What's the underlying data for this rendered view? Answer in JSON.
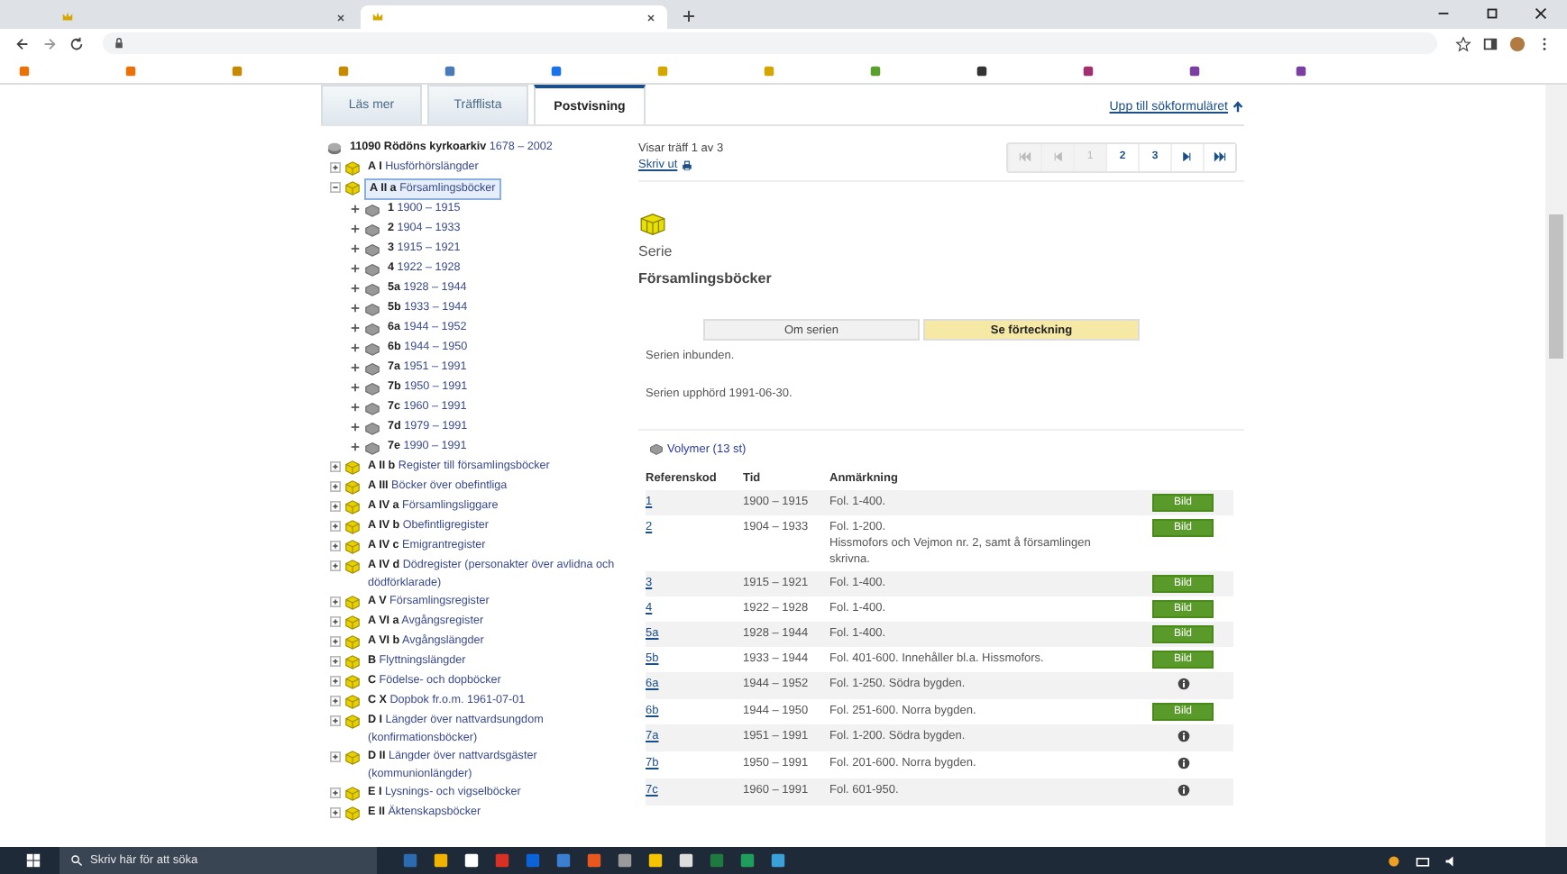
{
  "browser": {
    "tabs": [
      {
        "selected": false
      },
      {
        "selected": true
      }
    ]
  },
  "page_tabs": [
    {
      "label": "Läs mer",
      "selected": false
    },
    {
      "label": "Träfflista",
      "selected": false
    },
    {
      "label": "Postvisning",
      "selected": true
    }
  ],
  "top_link": "Upp till sökformuläret",
  "tree": {
    "root": "**11090 Rödöns kyrkoarkiv** 1678 – 2002",
    "items": [
      {
        "label": "**A I** Husförhörslängder",
        "expanded": false,
        "selected": false
      },
      {
        "label": "**A II a** Församlingsböcker",
        "expanded": true,
        "selected": true,
        "children": [
          {
            "label": "**1** 1900 – 1915",
            "expanded": false,
            "selected": false
          },
          {
            "label": "**2** 1904 – 1933",
            "expanded": false,
            "selected": false
          },
          {
            "label": "**3** 1915 – 1921",
            "expanded": false,
            "selected": false
          },
          {
            "label": "**4** 1922 – 1928",
            "expanded": false,
            "selected": false
          },
          {
            "label": "**5a** 1928 – 1944",
            "expanded": false,
            "selected": false
          },
          {
            "label": "**5b** 1933 – 1944",
            "expanded": false,
            "selected": false
          },
          {
            "label": "**6a** 1944 – 1952",
            "expanded": false,
            "selected": false
          },
          {
            "label": "**6b** 1944 – 1950",
            "expanded": false,
            "selected": false
          },
          {
            "label": "**7a** 1951 – 1991",
            "expanded": false,
            "selected": false
          },
          {
            "label": "**7b** 1950 – 1991",
            "expanded": false,
            "selected": false
          },
          {
            "label": "**7c** 1960 – 1991",
            "expanded": false,
            "selected": false
          },
          {
            "label": "**7d** 1979 – 1991",
            "expanded": false,
            "selected": false
          },
          {
            "label": "**7e** 1990 – 1991",
            "expanded": false,
            "selected": false
          }
        ]
      },
      {
        "label": "**A II b** Register till församlingsböcker",
        "expanded": false,
        "selected": false
      },
      {
        "label": "**A III** Böcker över obefintliga",
        "expanded": false,
        "selected": false
      },
      {
        "label": "**A IV a** Församlingsliggare",
        "expanded": false,
        "selected": false
      },
      {
        "label": "**A IV b** Obefintligregister",
        "expanded": false,
        "selected": false
      },
      {
        "label": "**A IV c** Emigrantregister",
        "expanded": false,
        "selected": false
      },
      {
        "label": "**A IV d** Dödregister (personakter över avlidna och dödförklarade)",
        "expanded": false,
        "selected": false
      },
      {
        "label": "**A V** Församlingsregister",
        "expanded": false,
        "selected": false
      },
      {
        "label": "**A VI a** Avgångsregister",
        "expanded": false,
        "selected": false
      },
      {
        "label": "**A VI b** Avgångslängder",
        "expanded": false,
        "selected": false
      },
      {
        "label": "**B** Flyttningslängder",
        "expanded": false,
        "selected": false
      },
      {
        "label": "**C** Födelse- och dopböcker",
        "expanded": false,
        "selected": false
      },
      {
        "label": "**C X** Dopbok fr.o.m. 1961-07-01",
        "expanded": false,
        "selected": false
      },
      {
        "label": "**D I** Längder över nattvardsungdom (konfirmationsböcker)",
        "expanded": false,
        "selected": false
      },
      {
        "label": "**D II** Längder över nattvardsgäster (kommunionlängder)",
        "expanded": false,
        "selected": false
      },
      {
        "label": "**E I** Lysnings- och vigselböcker",
        "expanded": false,
        "selected": false
      },
      {
        "label": "**E II** Äktenskapsböcker",
        "expanded": false,
        "selected": false
      }
    ]
  },
  "hits": "Visar träff 1 av 3",
  "print": "Skriv ut",
  "pagination": [
    {
      "kind": "first",
      "disabled": true
    },
    {
      "kind": "prev",
      "disabled": true
    },
    {
      "kind": "page",
      "label": "1",
      "selected": true
    },
    {
      "kind": "page",
      "label": "2",
      "selected": false
    },
    {
      "kind": "page",
      "label": "3",
      "selected": false
    },
    {
      "kind": "next",
      "disabled": false
    },
    {
      "kind": "last",
      "disabled": false
    }
  ],
  "series": {
    "type_label": "Serie",
    "title": "Församlingsböcker",
    "tabs": [
      {
        "label": "Om serien",
        "selected": false
      },
      {
        "label": "Se förteckning",
        "selected": true
      }
    ],
    "notes": [
      "Serien inbunden.",
      "Serien upphörd 1991-06-30."
    ]
  },
  "volumes": {
    "title": "Volymer (13 st)",
    "columns": [
      "Referenskod",
      "Tid",
      "Anmärkning"
    ],
    "rows": [
      {
        "ref": "1",
        "time": "1900 – 1915",
        "note": "Fol. 1-400.",
        "kind": "image",
        "action": "Bild"
      },
      {
        "ref": "2",
        "time": "1904 – 1933",
        "note": "Fol. 1-200.\nHissmofors och Vejmon nr. 2, samt å församlingen skrivna.",
        "kind": "image",
        "action": "Bild"
      },
      {
        "ref": "3",
        "time": "1915 – 1921",
        "note": "Fol. 1-400.",
        "kind": "image",
        "action": "Bild"
      },
      {
        "ref": "4",
        "time": "1922 – 1928",
        "note": "Fol. 1-400.",
        "kind": "image",
        "action": "Bild"
      },
      {
        "ref": "5a",
        "time": "1928 – 1944",
        "note": "Fol. 1-400.",
        "kind": "image",
        "action": "Bild"
      },
      {
        "ref": "5b",
        "time": "1933 – 1944",
        "note": "Fol. 401-600. Innehåller bl.a. Hissmofors.",
        "kind": "image",
        "action": "Bild"
      },
      {
        "ref": "6a",
        "time": "1944 – 1952",
        "note": "Fol. 1-250. Södra bygden.",
        "kind": "info"
      },
      {
        "ref": "6b",
        "time": "1944 – 1950",
        "note": "Fol. 251-600. Norra bygden.",
        "kind": "image",
        "action": "Bild"
      },
      {
        "ref": "7a",
        "time": "1951 – 1991",
        "note": "Fol. 1-200. Södra bygden.",
        "kind": "info"
      },
      {
        "ref": "7b",
        "time": "1950 – 1991",
        "note": "Fol. 201-600. Norra bygden.",
        "kind": "info"
      },
      {
        "ref": "7c",
        "time": "1960 – 1991",
        "note": "Fol. 601-950.",
        "kind": "info"
      }
    ]
  },
  "taskbar": {
    "search_placeholder": "Skriv här för att söka"
  }
}
